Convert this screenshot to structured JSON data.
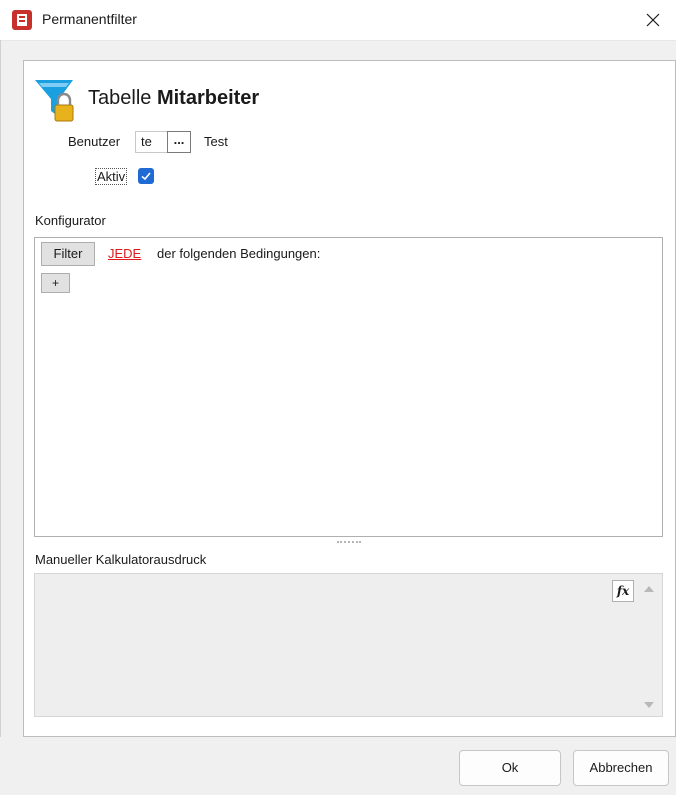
{
  "window": {
    "title": "Permanentfilter",
    "close_symbol": "✕",
    "icon": "app-icon"
  },
  "header": {
    "table_prefix": "Tabelle",
    "table_name": "Mitarbeiter",
    "icon": "funnel-lock-icon"
  },
  "user": {
    "label": "Benutzer",
    "value": "te",
    "browse_label": "...",
    "name": "Test"
  },
  "aktiv": {
    "label": "Aktiv",
    "checked": true
  },
  "konfigurator": {
    "label": "Konfigurator",
    "filter_button": "Filter",
    "mode_link": "JEDE",
    "condition_text": "der folgenden Bedingungen:",
    "add_button": "+"
  },
  "manual": {
    "label": "Manueller Kalkulatorausdruck",
    "fx_label": "fx",
    "value": ""
  },
  "buttons": {
    "ok": "Ok",
    "cancel": "Abbrechen"
  },
  "colors": {
    "link": "#e0191b",
    "check_blue": "#1f6ad3",
    "funnel_blue": "#1a9fe0",
    "lock_gold": "#e8b21c",
    "app_icon_red": "#c8302b"
  }
}
